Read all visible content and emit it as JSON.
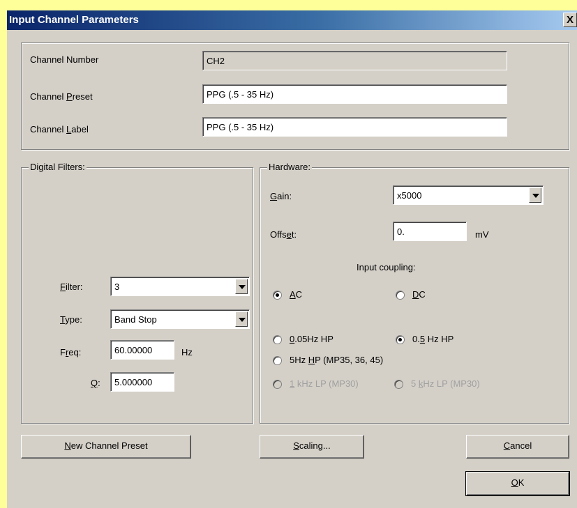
{
  "window": {
    "title": "Input Channel Parameters",
    "close_glyph": "X"
  },
  "channel": {
    "number_label": "Channel Number",
    "number_value": "CH2",
    "preset_label_pre": "Channel ",
    "preset_label_u": "P",
    "preset_label_post": "reset",
    "preset_value": "PPG (.5 - 35 Hz)",
    "label_label_pre": "Channel ",
    "label_label_u": "L",
    "label_label_post": "abel",
    "label_value": "PPG (.5 - 35 Hz)"
  },
  "digital_filters": {
    "group_label": "Digital Filters:",
    "filter_u": "F",
    "filter_post": "ilter:",
    "filter_value": "3",
    "type_u": "T",
    "type_post": "ype:",
    "type_value": "Band Stop",
    "freq_pre": "F",
    "freq_u": "r",
    "freq_post": "eq:",
    "freq_value": "60.00000",
    "freq_unit": "Hz",
    "q_u": "Q",
    "q_post": ":",
    "q_value": "5.000000"
  },
  "hardware": {
    "group_label": "Hardware:",
    "gain_u": "G",
    "gain_post": "ain:",
    "gain_value": "x5000",
    "offset_pre": "Offs",
    "offset_u": "e",
    "offset_post": "t:",
    "offset_value": "0.",
    "offset_unit": "mV",
    "coupling_label": "Input coupling:",
    "ac_u": "A",
    "ac_post": "C",
    "ac_checked": true,
    "dc_u": "D",
    "dc_post": "C",
    "dc_checked": false,
    "hp005_u": "0",
    "hp005_post": ".05Hz HP",
    "hp005_checked": false,
    "hp05_pre": "0.",
    "hp05_u": "5",
    "hp05_post": " Hz HP",
    "hp05_checked": true,
    "hp5_pre": "5Hz ",
    "hp5_u": "H",
    "hp5_post": "P (MP35, 36, 45)",
    "hp5_checked": false,
    "lp1_u": "1",
    "lp1_post": " kHz LP (MP30)",
    "lp5_pre": "5 ",
    "lp5_u": "k",
    "lp5_post": "Hz LP (MP30)"
  },
  "buttons": {
    "new_preset_u": "N",
    "new_preset_post": "ew Channel Preset",
    "scaling_u": "S",
    "scaling_post": "caling...",
    "cancel_u": "C",
    "cancel_post": "ancel",
    "ok_u": "O",
    "ok_post": "K"
  }
}
